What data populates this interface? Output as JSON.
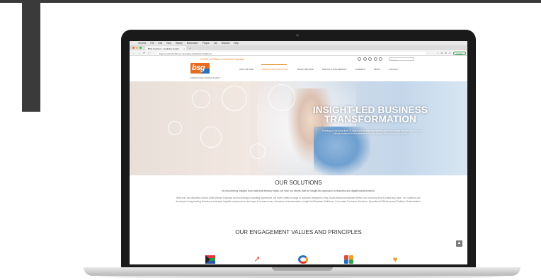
{
  "browser": {
    "menu_items": [
      "Chrome",
      "File",
      "Edit",
      "View",
      "History",
      "Bookmarks",
      "People",
      "Tab",
      "Window",
      "Help"
    ],
    "tab_title": "BSG Solutions - Enabling Insight",
    "tab_close": "×",
    "new_tab": "+",
    "url": "bsg.co.za/covid-19/ our-new-ways-working-innovations/",
    "update_label": "Update",
    "traffic_colors": [
      "#ff5f57",
      "#febc2e",
      "#28c840"
    ],
    "nav_icons": [
      "←",
      "→",
      "⟳",
      "⌂"
    ],
    "ext_icons": [
      "☆",
      "⧉",
      "⊕",
      "●"
    ]
  },
  "site": {
    "covid_link": "COVID-19 Official Government Updates",
    "search_placeholder": "Search",
    "logo_text": "bsg",
    "tagline": "Enabling Insight | Realising Ambition",
    "nav": [
      "WHO WE ARE",
      "INSIGHT-LED SOLUTIONS",
      "TRACK RECORD",
      "MAKING A DIFFERENCE",
      "CAREERS",
      "NEWS",
      "CONTACT"
    ],
    "active_nav": "INSIGHT-LED SOLUTIONS",
    "accent_color": "#e08420"
  },
  "hero": {
    "headline_line1": "INSIGHT-LED BUSINESS",
    "headline_line2": "TRANSFORMATION",
    "text": "Drawing on our more than 20 years of local experience and passion for quality delivery, we help our clients transform their businesses through Insight, Discovery and Innovation."
  },
  "solutions": {
    "title": "OUR SOLUTIONS",
    "lead": "By discovering insights from data that already exists, we help our clients take an insight-led approach to business and digital transformation.",
    "body": "With over two decades of local South African business and technology consulting experience, we have crafted a range of solutions designed to help South African businesses thrive in an economy that is unlike any other. Our solutions are developed using leading industry and analyst insights and practices, and span four main areas of business transformation: Insight-led Business Solutions, Connected Customer Solutions, Operational Efficiency and Platform Modernisation."
  },
  "values": {
    "title": "OUR ENGAGEMENT VALUES AND PRINCIPLES",
    "icons": [
      "south-africa-flag-icon",
      "growth-graph-icon",
      "ring-icon",
      "puzzle-icon",
      "heart-icon"
    ]
  },
  "scroll_top_glyph": "▲"
}
